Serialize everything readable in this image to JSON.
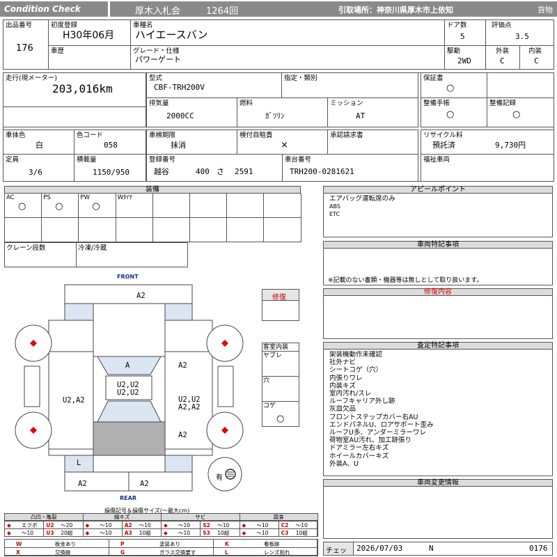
{
  "header": {
    "left": "Condition  Check",
    "auction": "厚木入札会",
    "lot": "1264回",
    "pickup": "引取場所：神奈川県厚木市上依知",
    "type": "貨物"
  },
  "top": {
    "lot_no_label": "出品番号",
    "lot_no": "176",
    "first_reg_label": "初度登録",
    "first_reg": "H30年06月",
    "car_name_label": "車種名",
    "car_name": "ハイエースバン",
    "doors_label": "ドア数",
    "doors": "5",
    "score_label": "評価点",
    "score": "3.5",
    "history_label": "車歴",
    "grade_label": "グレード・仕様",
    "grade": "パワーゲート",
    "drive_label": "駆動",
    "drive": "2WD",
    "ext_label": "外装",
    "ext": "C",
    "int_label": "内装",
    "int": "C"
  },
  "spec": {
    "mileage_label": "走行(現メーター)",
    "mileage": "203,016km",
    "model_label": "型式",
    "model": "CBF-TRH200V",
    "designation_label": "指定・類別",
    "warranty_label": "保証書",
    "warranty": "○",
    "displacement_label": "排気量",
    "displacement": "2000CC",
    "fuel_label": "燃料",
    "fuel": "ｶﾞｿﾘﾝ",
    "mission_label": "ミッション",
    "mission": "AT",
    "maint_book_label": "整備手帳",
    "maint_book": "○",
    "maint_record_label": "整備記録",
    "maint_record": "○",
    "body_color_label": "車体色",
    "body_color": "白",
    "color_code_label": "色コード",
    "color_code": "058",
    "inspection_label": "車検期限",
    "inspection": "抹消",
    "liability_label": "検付自賠責",
    "liability": "×",
    "approval_label": "承認請求書",
    "recycle_label": "リサイクル料",
    "recycle_status": "預託済",
    "recycle_fee": "9,730円",
    "capacity_label": "定員",
    "capacity": "3/6",
    "load_label": "積載量",
    "load": "1150/950",
    "reg_no_label": "登録番号",
    "reg_area": "越谷",
    "reg_class": "400",
    "reg_kana": "さ",
    "reg_num": "2591",
    "chassis_label": "車台番号",
    "chassis": "TRH200-0281621",
    "welfare_label": "福祉車両"
  },
  "equipment": {
    "title": "装備",
    "items": [
      {
        "label": "AC",
        "mark": "○"
      },
      {
        "label": "PS",
        "mark": "○"
      },
      {
        "label": "PW",
        "mark": "○"
      },
      {
        "label": "Wﾀｲﾔ",
        "mark": ""
      }
    ],
    "crane_label": "クレーン段数",
    "freezer_label": "冷凍/冷蔵"
  },
  "appeal": {
    "title": "アピールポイント",
    "lines": [
      "エアバッグ運転席のみ",
      "ABS",
      "ETC"
    ]
  },
  "special": {
    "title": "車両特記事項",
    "note": "※記載のない書類・機器等は無しとして取り扱います。"
  },
  "repair": {
    "title": "修復内容",
    "badge": "修復"
  },
  "inspect": {
    "title": "査定特記事項",
    "lines": [
      "架装機動作未確認",
      "社外ナビ",
      "シートコゲ（穴）",
      "内張りワレ",
      "内装キズ",
      "室内汚れ/スレ",
      "ルーフキャリア外し跡",
      "灰皿欠品",
      "フロントステップカバー右AU",
      "エンドパネルU、ロアサポート歪み",
      "ルーフU多、アンダーミラーワレ",
      "荷物室AU汚れ、加工跡張り",
      "ドアミラー左右キズ",
      "ホイールカバーキズ",
      "外装A、U"
    ]
  },
  "change": {
    "title": "車両変更情報"
  },
  "diagram": {
    "front": "FRONT",
    "rear": "REAR",
    "marks": {
      "front_bumper": "A2",
      "hood": "A",
      "left_front": "A2",
      "roof": "U2,U2\nU2,U2",
      "right_side": "U2,A2",
      "left_side": "U2,U2\nA2,A2",
      "left_rear": "A2",
      "rear_left_lamp": "L",
      "rear_bumper_r": "A2",
      "rear_bumper_l": "A2"
    },
    "interior_title": "客室内装",
    "interior": [
      {
        "label": "ヤブレ",
        "mark": ""
      },
      {
        "label": "穴",
        "mark": ""
      },
      {
        "label": "コゲ",
        "mark": "○"
      }
    ],
    "spare_label": "有"
  },
  "legend": {
    "title": "損傷記号＆損傷サイズ(～最大cm)",
    "groups": [
      "凸凹・亀裂",
      "線キズ",
      "サビ",
      "腐食"
    ],
    "row1": [
      {
        "sym": "◆",
        "txt": "エクボ"
      },
      {
        "sym": "U2",
        "txt": "～20"
      },
      {
        "sym": "◆",
        "txt": "～10"
      },
      {
        "sym": "A2",
        "txt": "～10"
      },
      {
        "sym": "◆",
        "txt": "～10"
      },
      {
        "sym": "S2",
        "txt": "～10"
      },
      {
        "sym": "◆",
        "txt": "～10"
      },
      {
        "sym": "C2",
        "txt": "～10"
      }
    ],
    "row2": [
      {
        "sym": "◆",
        "txt": "～10"
      },
      {
        "sym": "U3",
        "txt": "20超"
      },
      {
        "sym": "◆",
        "txt": "～10"
      },
      {
        "sym": "A3",
        "txt": "10超"
      },
      {
        "sym": "◆",
        "txt": "～10"
      },
      {
        "sym": "S3",
        "txt": "10超"
      },
      {
        "sym": "◆",
        "txt": "～10"
      },
      {
        "sym": "C3",
        "txt": "10超"
      }
    ],
    "codes": [
      {
        "sym": "W",
        "txt": "板金あり"
      },
      {
        "sym": "P",
        "txt": "塗装あり"
      },
      {
        "sym": "K",
        "txt": "看板跡"
      },
      {
        "sym": "X",
        "txt": "交換跡"
      },
      {
        "sym": "G",
        "txt": "ガラス交換要す"
      },
      {
        "sym": "L",
        "txt": "レンズ割れ"
      }
    ]
  },
  "check": {
    "label": "チェック",
    "date": "2026/07/03",
    "flag": "N",
    "number": "0176"
  },
  "colors": {
    "accent_red": "#cc0000",
    "header_gray": "#8a8a8a",
    "damage_blue": "#dbe6f3"
  }
}
